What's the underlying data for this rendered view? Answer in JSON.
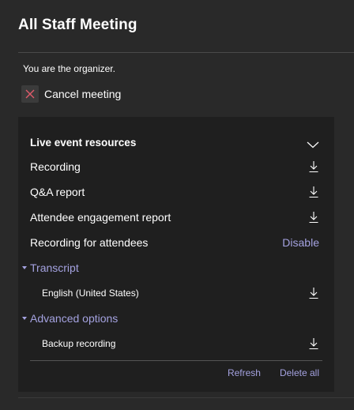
{
  "header": {
    "title": "All Staff Meeting"
  },
  "organizer_text": "You are the organizer.",
  "cancel_button": {
    "label": "Cancel meeting",
    "icon": "close-icon"
  },
  "resources": {
    "heading": "Live event resources",
    "items": [
      {
        "label": "Recording",
        "action": "download-icon"
      },
      {
        "label": "Q&A report",
        "action": "download-icon"
      },
      {
        "label": "Attendee engagement report",
        "action": "download-icon"
      },
      {
        "label": "Recording for attendees",
        "action_label": "Disable"
      }
    ],
    "transcript": {
      "label": "Transcript",
      "items": [
        {
          "label": "English (United States)",
          "action": "download-icon"
        }
      ]
    },
    "advanced": {
      "label": "Advanced options",
      "items": [
        {
          "label": "Backup recording",
          "action": "download-icon"
        }
      ]
    },
    "footer": {
      "refresh_label": "Refresh",
      "delete_all_label": "Delete all"
    }
  },
  "colors": {
    "background": "#292929",
    "panel": "#1f1f1f",
    "accent": "#a4a2e0",
    "cancel_icon": "#e05a6a"
  }
}
